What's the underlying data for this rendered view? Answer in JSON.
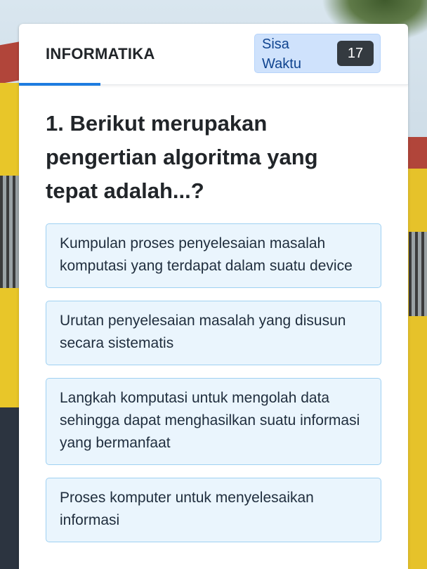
{
  "header": {
    "subject": "INFORMATIKA",
    "timer_label": "Sisa Waktu",
    "timer_value": "17"
  },
  "question": {
    "text": "1. Berikut merupakan pengertian algoritma yang tepat adalah...?"
  },
  "options": [
    {
      "label": "Kumpulan proses penyelesaian masalah komputasi yang terdapat dalam suatu device"
    },
    {
      "label": "Urutan penyelesaian masalah yang disusun secara sistematis"
    },
    {
      "label": "Langkah komputasi untuk mengolah data sehingga dapat menghasilkan suatu informasi yang bermanfaat"
    },
    {
      "label": "Proses komputer untuk menyelesaikan informasi"
    }
  ],
  "colors": {
    "accent": "#1e7ce0",
    "timer_bg": "#cfe2fc",
    "timer_badge": "#343a40",
    "option_bg": "#eaf5fd",
    "option_border": "#9fd1f2"
  }
}
